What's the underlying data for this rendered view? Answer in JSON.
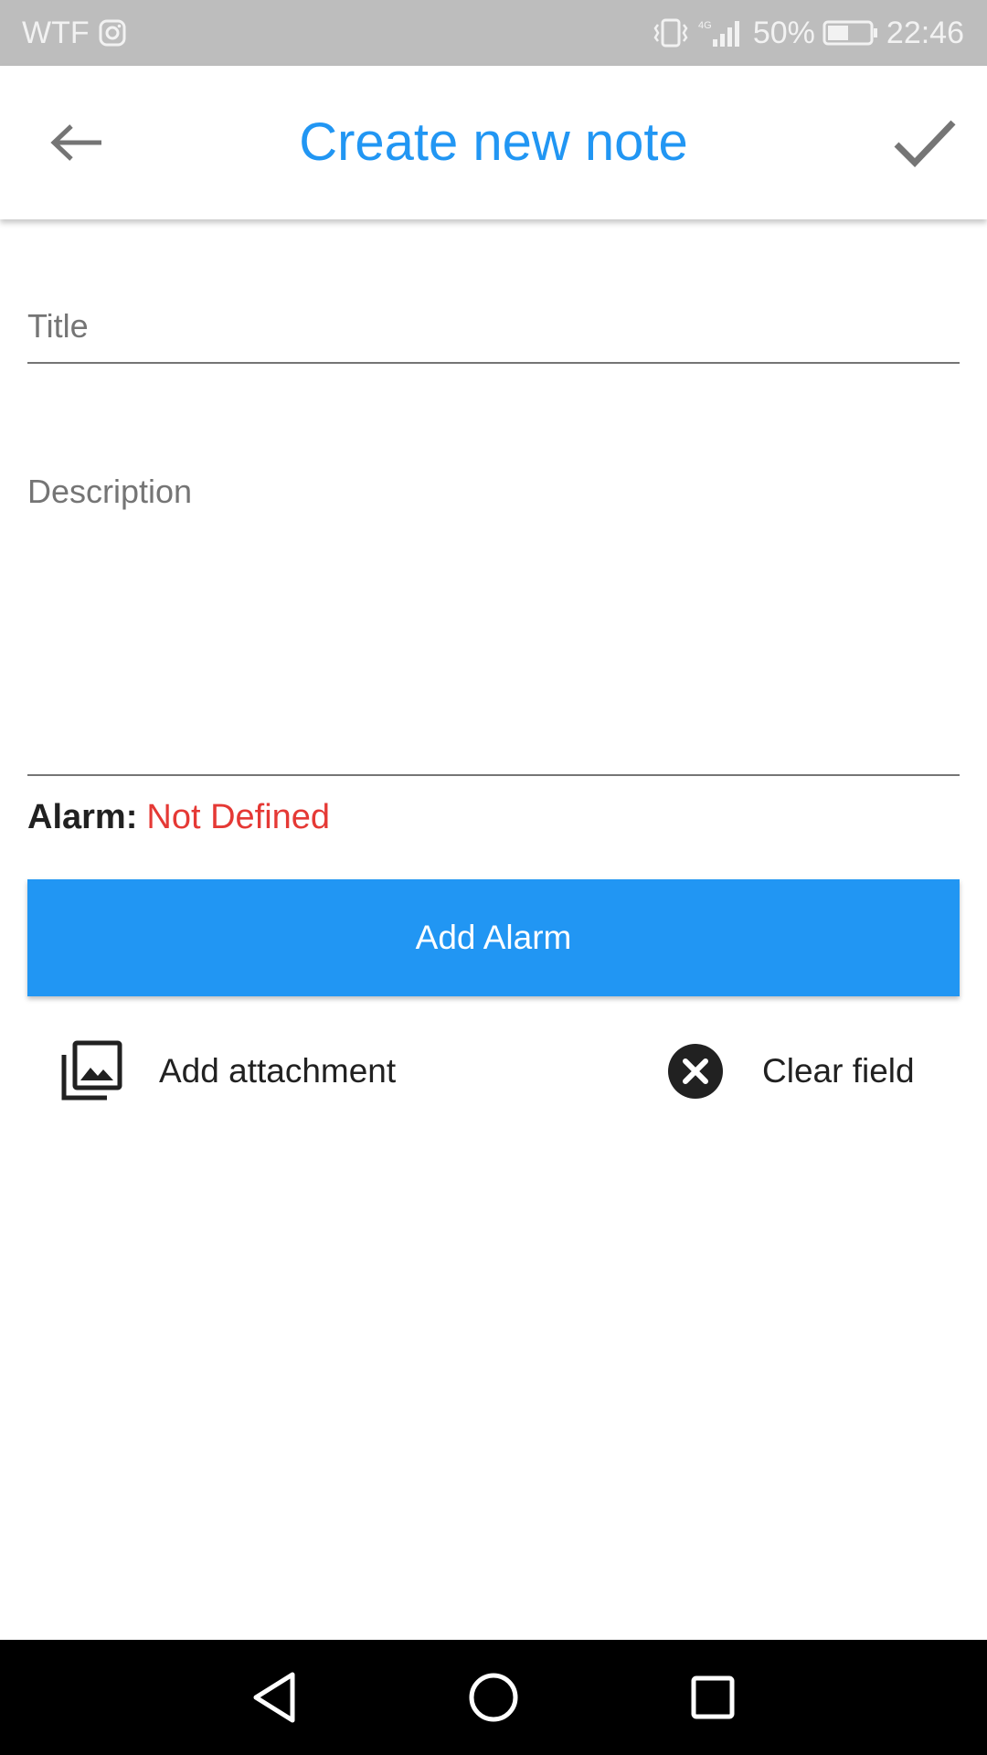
{
  "status_bar": {
    "carrier": "WTF",
    "network": "4G",
    "battery": "50%",
    "time": "22:46"
  },
  "toolbar": {
    "title": "Create new note",
    "back_icon": "arrow-back-icon",
    "confirm_icon": "check-icon"
  },
  "form": {
    "title_placeholder": "Title",
    "title_value": "",
    "description_placeholder": "Description",
    "description_value": ""
  },
  "alarm": {
    "label": "Alarm:",
    "value": "Not Defined",
    "value_color": "#e53935",
    "button_label": "Add Alarm",
    "button_color": "#2196f3"
  },
  "actions": {
    "attachment_label": "Add attachment",
    "attachment_icon": "photo-library-icon",
    "clear_label": "Clear field",
    "clear_icon": "cancel-circle-icon"
  },
  "nav_bar": {
    "back_icon": "nav-back-icon",
    "home_icon": "nav-home-icon",
    "recents_icon": "nav-recents-icon"
  },
  "colors": {
    "accent": "#2196f3",
    "status_bar_bg": "#bdbdbd",
    "nav_bar_bg": "#000000"
  }
}
